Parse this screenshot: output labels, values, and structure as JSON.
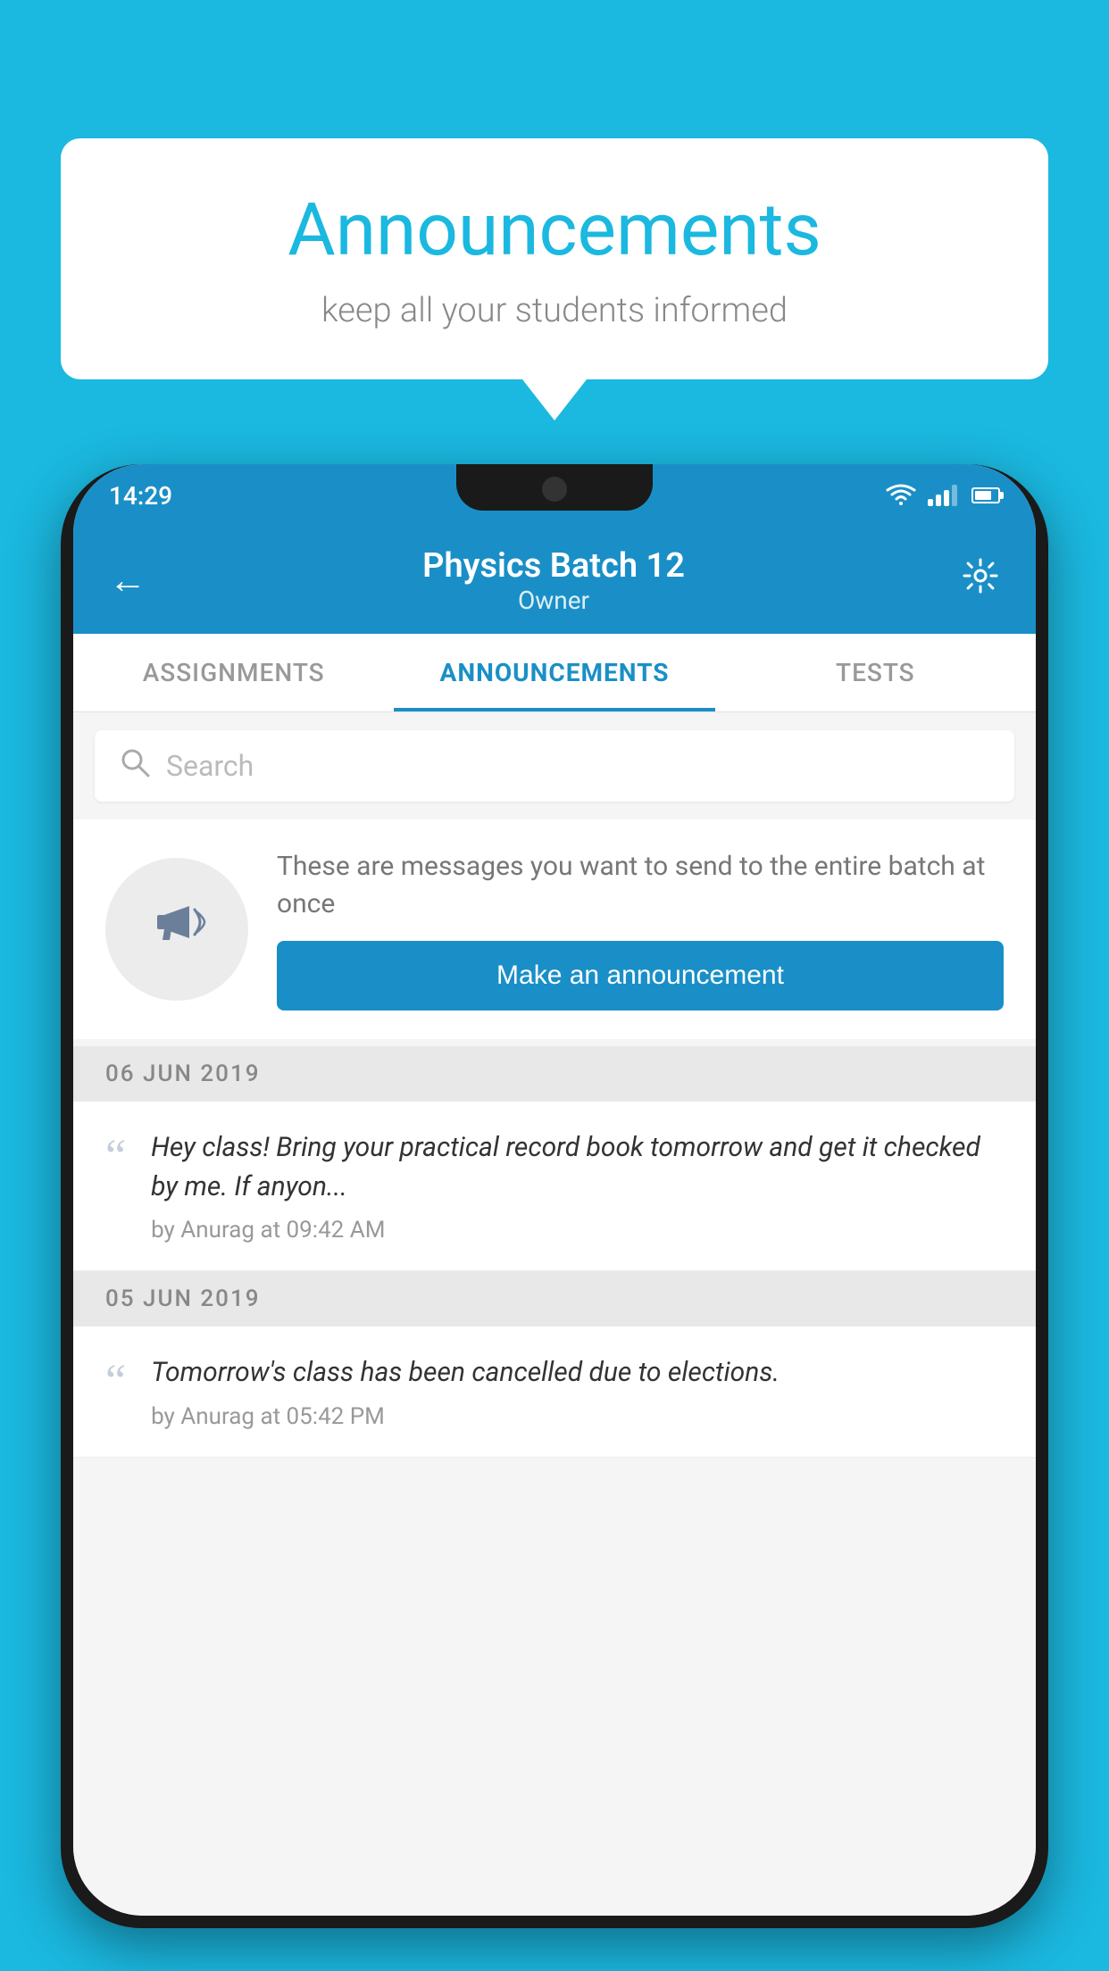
{
  "background_color": "#1bb8e0",
  "speech_bubble": {
    "title": "Announcements",
    "subtitle": "keep all your students informed"
  },
  "phone": {
    "status_bar": {
      "time": "14:29"
    },
    "header": {
      "title": "Physics Batch 12",
      "subtitle": "Owner",
      "back_label": "←",
      "settings_label": "⚙"
    },
    "tabs": [
      {
        "label": "ASSIGNMENTS",
        "active": false
      },
      {
        "label": "ANNOUNCEMENTS",
        "active": true
      },
      {
        "label": "TESTS",
        "active": false
      }
    ],
    "search": {
      "placeholder": "Search"
    },
    "promo": {
      "description": "These are messages you want to send to the entire batch at once",
      "button_label": "Make an announcement"
    },
    "announcements": [
      {
        "date": "06  JUN  2019",
        "text": "Hey class! Bring your practical record book tomorrow and get it checked by me. If anyon...",
        "meta": "by Anurag at 09:42 AM"
      },
      {
        "date": "05  JUN  2019",
        "text": "Tomorrow's class has been cancelled due to elections.",
        "meta": "by Anurag at 05:42 PM"
      }
    ]
  }
}
